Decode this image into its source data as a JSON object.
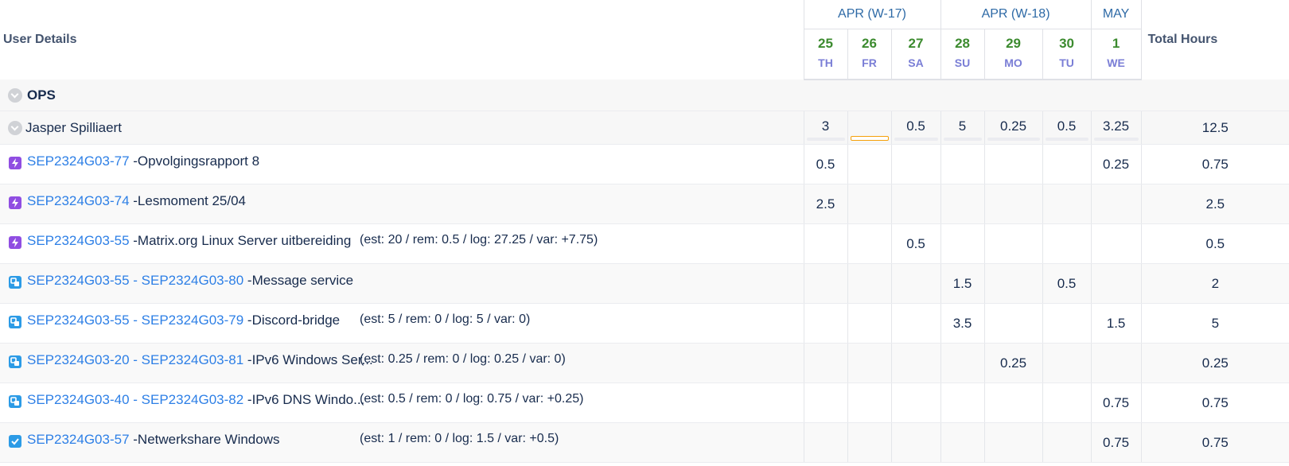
{
  "header": {
    "user_details_label": "User Details",
    "total_label": "Total Hours",
    "weeks": [
      {
        "label": "APR (W-17)",
        "span": 3
      },
      {
        "label": "APR (W-18)",
        "span": 3
      },
      {
        "label": "MAY",
        "span": 1
      }
    ],
    "days": [
      {
        "num": "25",
        "dow": "TH"
      },
      {
        "num": "26",
        "dow": "FR"
      },
      {
        "num": "27",
        "dow": "SA"
      },
      {
        "num": "28",
        "dow": "SU"
      },
      {
        "num": "29",
        "dow": "MO"
      },
      {
        "num": "30",
        "dow": "TU"
      },
      {
        "num": "1",
        "dow": "WE"
      }
    ]
  },
  "group": {
    "name": "OPS",
    "icon": "chevron-down-icon"
  },
  "user": {
    "name": "Jasper Spilliaert",
    "icon": "chevron-down-icon",
    "days": [
      "3",
      "",
      "0.5",
      "5",
      "0.25",
      "0.5",
      "3.25"
    ],
    "progress": [
      0.375,
      0,
      0.0625,
      0.625,
      0.03125,
      0.0625,
      0.40625
    ],
    "total": "12.5"
  },
  "issues": [
    {
      "type": "story",
      "icon": "lightning-icon",
      "key": "SEP2324G03-77",
      "summary": " -Opvolgingsrapport 8",
      "est": "",
      "days": [
        "0.5",
        "",
        "",
        "",
        "",
        "",
        "0.25"
      ],
      "total": "0.75"
    },
    {
      "type": "story",
      "icon": "lightning-icon",
      "key": "SEP2324G03-74",
      "summary": " -Lesmoment 25/04",
      "est": "",
      "days": [
        "2.5",
        "",
        "",
        "",
        "",
        "",
        ""
      ],
      "total": "2.5"
    },
    {
      "type": "story",
      "icon": "lightning-icon",
      "key": "SEP2324G03-55",
      "summary": " -Matrix.org Linux Server uitbereiding",
      "est": "(est: 20 / rem: 0.5 / log: 27.25 / var: +7.75)",
      "days": [
        "",
        "",
        "0.5",
        "",
        "",
        "",
        ""
      ],
      "total": "0.5"
    },
    {
      "type": "sub",
      "icon": "subtask-icon",
      "key": "SEP2324G03-55 - SEP2324G03-80",
      "summary": " -Message service",
      "est": "",
      "days": [
        "",
        "",
        "",
        "1.5",
        "",
        "0.5",
        ""
      ],
      "total": "2"
    },
    {
      "type": "sub",
      "icon": "subtask-icon",
      "key": "SEP2324G03-55 - SEP2324G03-79",
      "summary": " -Discord-bridge",
      "est": "(est: 5 / rem: 0 / log: 5 / var: 0)",
      "days": [
        "",
        "",
        "",
        "3.5",
        "",
        "",
        "1.5"
      ],
      "total": "5"
    },
    {
      "type": "sub",
      "icon": "subtask-icon",
      "key": "SEP2324G03-20 - SEP2324G03-81",
      "summary": " -IPv6 Windows Ser...",
      "est": "(est: 0.25 / rem: 0 / log: 0.25 / var: 0)",
      "days": [
        "",
        "",
        "",
        "",
        "0.25",
        "",
        ""
      ],
      "total": "0.25"
    },
    {
      "type": "sub",
      "icon": "subtask-icon",
      "key": "SEP2324G03-40 - SEP2324G03-82",
      "summary": " -IPv6 DNS Windo...",
      "est": "(est: 0.5 / rem: 0 / log: 0.75 / var: +0.25)",
      "days": [
        "",
        "",
        "",
        "",
        "",
        "",
        "0.75"
      ],
      "total": "0.75"
    },
    {
      "type": "task",
      "icon": "checkbox-icon",
      "key": "SEP2324G03-57",
      "summary": " -Netwerkshare Windows",
      "est": "(est: 1 / rem: 0 / log: 1.5 / var: +0.5)",
      "days": [
        "",
        "",
        "",
        "",
        "",
        "",
        "0.75"
      ],
      "total": "0.75"
    }
  ]
}
